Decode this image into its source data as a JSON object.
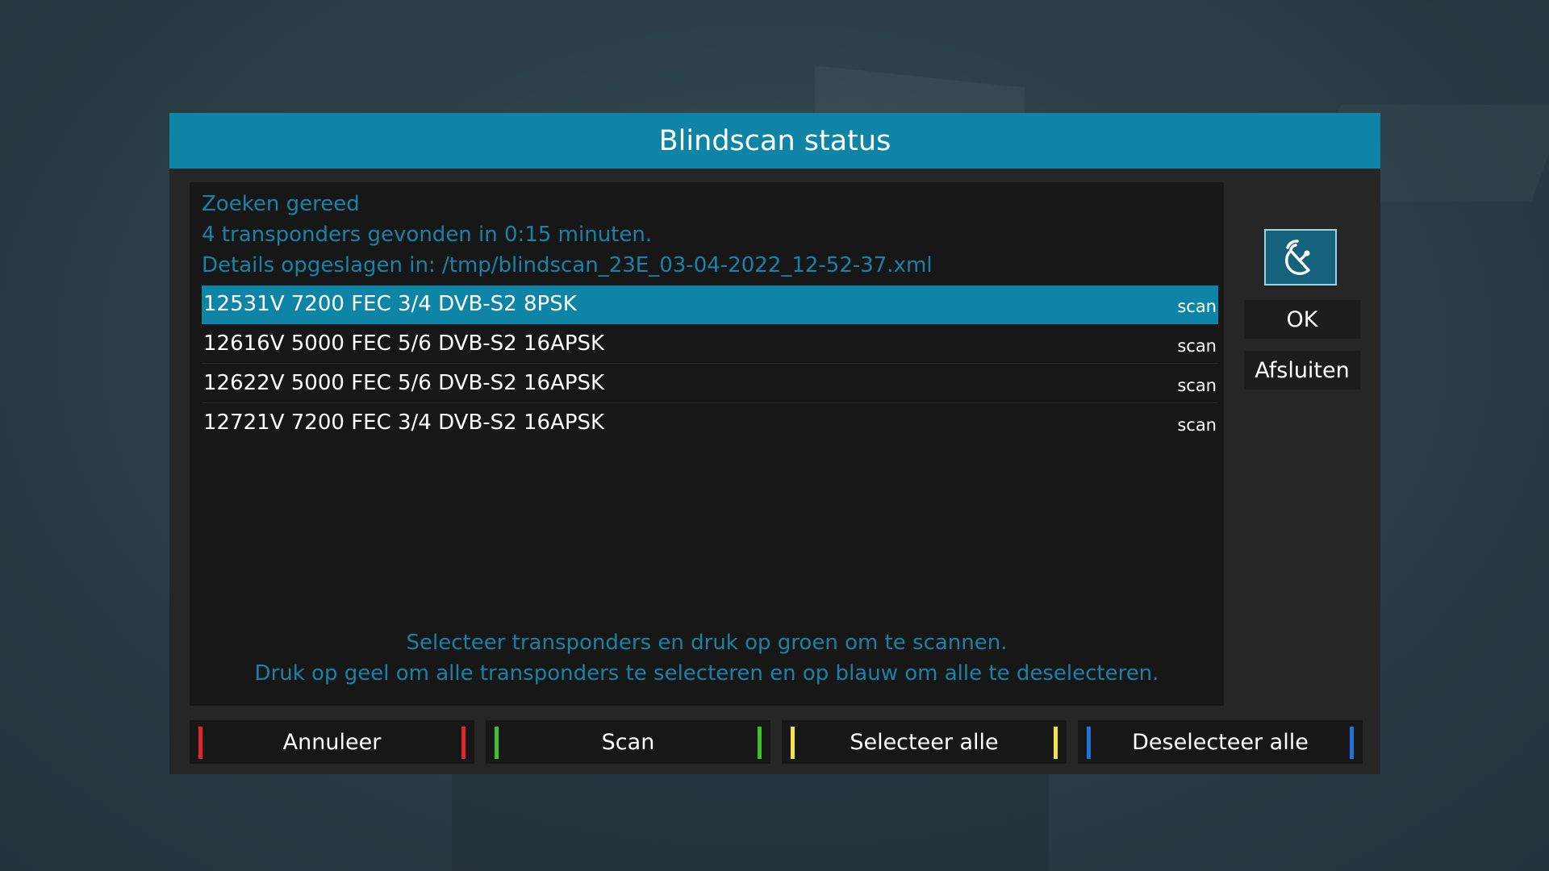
{
  "dialog": {
    "title": "Blindscan status"
  },
  "status": {
    "line1": "Zoeken gereed",
    "line2": "4 transponders gevonden in 0:15 minuten.",
    "line3": "Details opgeslagen in: /tmp/blindscan_23E_03-04-2022_12-52-37.xml"
  },
  "transponders": [
    {
      "label": "12531V 7200 FEC 3/4 DVB-S2 8PSK",
      "tag": "scan",
      "selected": true
    },
    {
      "label": "12616V 5000 FEC 5/6 DVB-S2 16APSK",
      "tag": "scan",
      "selected": false
    },
    {
      "label": "12622V 5000 FEC 5/6 DVB-S2 16APSK",
      "tag": "scan",
      "selected": false
    },
    {
      "label": "12721V 7200 FEC 3/4 DVB-S2 16APSK",
      "tag": "scan",
      "selected": false
    }
  ],
  "hint": {
    "line1": "Selecteer transponders en druk op groen om te scannen.",
    "line2": "Druk op geel om alle transponders te selecteren en op blauw om alle te deselecteren."
  },
  "side": {
    "icon": "satellite-dish-icon",
    "ok_label": "OK",
    "exit_label": "Afsluiten"
  },
  "color_buttons": {
    "red_label": "Annuleer",
    "green_label": "Scan",
    "yellow_label": "Selecteer alle",
    "blue_label": "Deselecteer alle"
  },
  "colors": {
    "accent": "#0e85a6",
    "info_text": "#1a82a6",
    "red": "#e0262b",
    "green": "#3ec12b",
    "yellow": "#f0e44a",
    "blue": "#1e73d8"
  }
}
